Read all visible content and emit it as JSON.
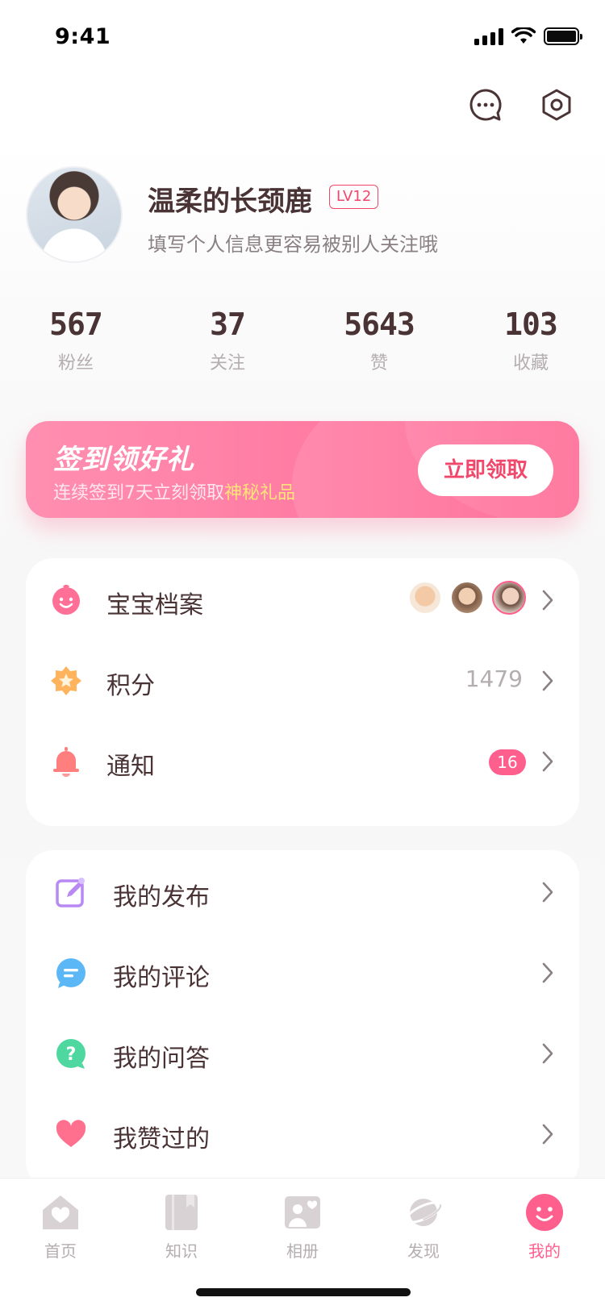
{
  "status_bar": {
    "time": "9:41"
  },
  "profile": {
    "name": "温柔的长颈鹿",
    "level": "LV12",
    "subtitle": "填写个人信息更容易被别人关注哦"
  },
  "stats": [
    {
      "value": "567",
      "label": "粉丝"
    },
    {
      "value": "37",
      "label": "关注"
    },
    {
      "value": "5643",
      "label": "赞"
    },
    {
      "value": "103",
      "label": "收藏"
    }
  ],
  "signin_banner": {
    "title": "签到领好礼",
    "subtitle_prefix": "连续签到7天立刻领取",
    "subtitle_highlight": "神秘礼品",
    "button": "立即领取"
  },
  "menu_primary": [
    {
      "label": "宝宝档案",
      "icon": "baby-face-icon"
    },
    {
      "label": "积分",
      "icon": "star-badge-icon",
      "value": "1479"
    },
    {
      "label": "通知",
      "icon": "bell-icon",
      "badge": "16"
    }
  ],
  "menu_secondary": [
    {
      "label": "我的发布",
      "icon": "edit-icon"
    },
    {
      "label": "我的评论",
      "icon": "comment-icon"
    },
    {
      "label": "我的问答",
      "icon": "question-icon"
    },
    {
      "label": "我赞过的",
      "icon": "heart-icon"
    }
  ],
  "tabbar": [
    {
      "label": "首页",
      "icon": "home-icon",
      "active": false
    },
    {
      "label": "知识",
      "icon": "book-icon",
      "active": false
    },
    {
      "label": "相册",
      "icon": "album-icon",
      "active": false
    },
    {
      "label": "发现",
      "icon": "planet-icon",
      "active": false
    },
    {
      "label": "我的",
      "icon": "smile-icon",
      "active": true
    }
  ],
  "colors": {
    "accent": "#ff5f8d",
    "level_badge": "#f0476b",
    "text_primary": "#4a3335",
    "text_secondary": "#b5aeb0",
    "highlight": "#ffe27a"
  }
}
